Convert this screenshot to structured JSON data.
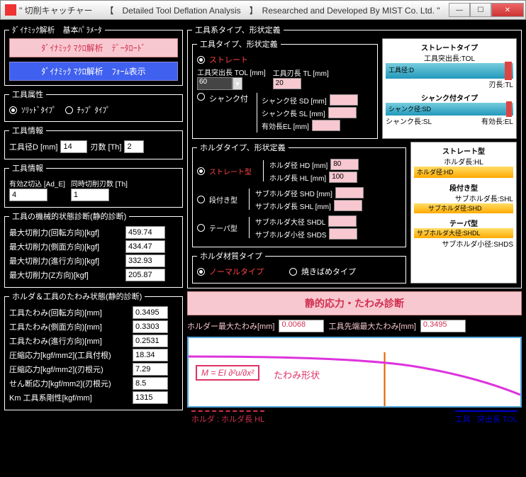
{
  "window": {
    "title": "\" 切削キャッチャー　　【　Detailed Tool Deflation Analysis　】　Researched and Developed By MIST Co. Ltd. \""
  },
  "left": {
    "group1": {
      "legend": "ﾀﾞｲﾅﾐｯｸ解析　基本ﾊﾟﾗﾒｰﾀ",
      "btn1": "ﾀﾞｲﾅﾐｯｸ ﾏｸﾛ解析　ﾃﾞｰﾀﾛｰﾄﾞ",
      "btn2": "ﾀﾞｲﾅﾐｯｸ ﾏｸﾛ解析　ﾌｫｰﾑ表示"
    },
    "group2": {
      "legend": "工具属性",
      "r1": "ｿﾘｯﾄﾞﾀｲﾌﾟ",
      "r2": "ﾁｯﾌﾟ ﾀｲﾌﾟ"
    },
    "group3": {
      "legend": "工具情報",
      "l1": "工具径D [mm]",
      "v1": "14",
      "l2": "刃数 [Th]",
      "v2": "2"
    },
    "group4": {
      "legend": "工具情報",
      "l1": "有効Z切込 [Ad_E]",
      "v1": "4",
      "l2": "同時切削刃数 [Th]",
      "v2": "1"
    },
    "group5": {
      "legend": "工具の機械的状態診断(静的診断)",
      "rows": [
        {
          "l": "最大切削力(回転方向)[kgf]",
          "v": "459.74"
        },
        {
          "l": "最大切削力(側面方向)[kgf]",
          "v": "434.47"
        },
        {
          "l": "最大切削力(進行方向)[kgf]",
          "v": "332.93"
        },
        {
          "l": "最大切削力(Z方向)[kgf]",
          "v": "205.87"
        }
      ]
    },
    "group6": {
      "legend": "ホルダ＆工具のたわみ状態(静的診断)",
      "rows": [
        {
          "l": "工具たわみ(回転方向)[mm]",
          "v": "0.3495"
        },
        {
          "l": "工具たわみ(側面方向)[mm]",
          "v": "0.3303"
        },
        {
          "l": "工具たわみ(進行方向)[mm]",
          "v": "0.2531"
        },
        {
          "l": "圧縮応力[kgf/mm2](工具付根)",
          "v": "18.34"
        },
        {
          "l": "圧縮応力[kgf/mm2](刃根元)",
          "v": "7.29"
        },
        {
          "l": "せん断応力[kgf/mm2](刃根元)",
          "v": "8.5"
        },
        {
          "l": "Km 工具系剛性[kgf/mm]",
          "v": "1315"
        }
      ]
    }
  },
  "right": {
    "group1": {
      "legend": "工具系タイプ、形状定義"
    },
    "toolshape": {
      "legend": "工具タイプ、形状定義",
      "r1": "ストレート",
      "r2": "シャンク付",
      "tol": "工具突出長 TOL [mm]",
      "tolv": "60",
      "tl": "工具刃長 TL [mm]",
      "tlv": "20",
      "sd": "シャンク径 SD [mm]",
      "sl": "シャンク長 SL [mm]",
      "el": "有効長EL [mm]"
    },
    "holder": {
      "legend": "ホルダタイプ、形状定義",
      "r1": "ストレート型",
      "r2": "段付き型",
      "r3": "テーパ型",
      "hd": "ホルダ径 HD [mm]",
      "hdv": "80",
      "hl": "ホルダ長 HL [mm]",
      "hlv": "100",
      "shd": "サブホルダ径 SHD [mm]",
      "shl": "サブホルダ長 SHL [mm]",
      "shdl": "サブホルダ大径 SHDL",
      "shds": "サブホルダ小径 SHDS"
    },
    "mat": {
      "legend": "ホルダ材質タイプ",
      "r1": "ノーマルタイプ",
      "r2": "焼きばめタイプ"
    },
    "diag1": {
      "t1": "ストレートタイプ",
      "t1a": "工具突出長:TOL",
      "t1b": "工具径:D",
      "t1c": "刃長:TL",
      "t2": "シャンク付タイプ",
      "t2a": "シャンク径:SD",
      "t2b": "シャンク長:SL",
      "t2c": "有効長:EL"
    },
    "diag2": {
      "t1": "ストレート型",
      "t1a": "ホルダ長:HL",
      "t1b": "ホルダ径:HD",
      "t2": "段付き型",
      "t2a": "サブホルダ長:SHL",
      "t2b": "サブホルダ径:SHD",
      "t3": "テーパ型",
      "t3a": "サブホルダ大径:SHDL",
      "t3b": "サブホルダ小径:SHDS"
    },
    "diagbtn": "静的応力・たわみ診断",
    "res": {
      "l1": "ホルダー最大たわみ[mm]",
      "v1": "0.0068",
      "l2": "工具先端最大たわみ[mm]",
      "v2": "0.3495"
    },
    "graph": {
      "formula": "M = EI ∂²u/∂x²",
      "label": "たわみ形状",
      "foot_l": "ホルダ : ホルダ長 HL",
      "foot_r": "工具 : 突出長 TOL"
    }
  }
}
